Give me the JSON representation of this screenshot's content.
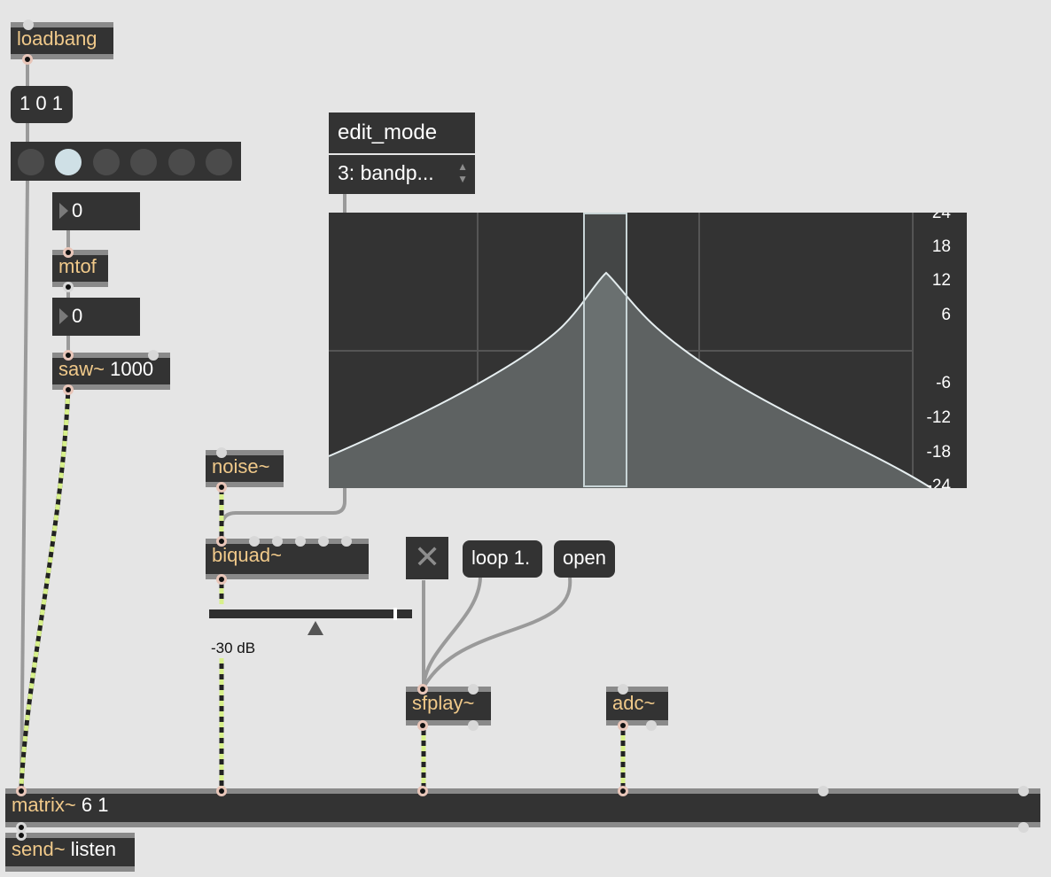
{
  "objects": {
    "loadbang": "loadbang",
    "message_101": "1 0 1",
    "number1": "0",
    "mtof": "mtof",
    "number2": "0",
    "saw_class": "saw~",
    "saw_args": "1000",
    "noise": "noise~",
    "biquad": "biquad~",
    "sfplay": "sfplay~",
    "adc": "adc~",
    "matrix_class": "matrix~",
    "matrix_args": "6 1",
    "send_class": "send~",
    "send_args": "listen"
  },
  "messages": {
    "loop": "loop 1.",
    "open": "open"
  },
  "umenu": {
    "label": "edit_mode",
    "selected": "3: bandp..."
  },
  "radiogroup": {
    "count": 6,
    "selected_index": 1
  },
  "filtergraph": {
    "y_labels": [
      "24",
      "18",
      "12",
      "6",
      "",
      "-6",
      "-12",
      "-18",
      "-24"
    ],
    "mode": "bandpass",
    "curve_color": "#e6eef0",
    "fill_color": "#5e6262"
  },
  "gain": {
    "value_label": "-30 dB"
  },
  "colors": {
    "object_bg": "#333333",
    "class_text": "#f0c98a",
    "signal_cable": "#d7f08a",
    "control_cable": "#a8a8a8",
    "canvas_bg": "#e5e5e5"
  }
}
